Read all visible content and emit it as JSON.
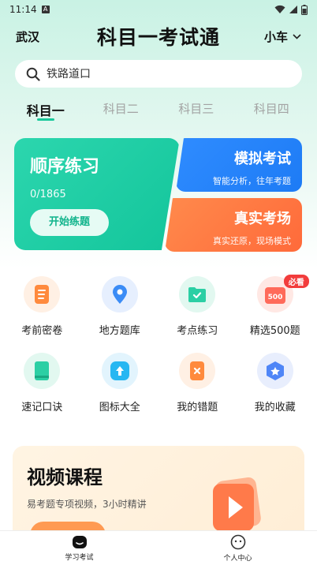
{
  "status_bar": {
    "time": "11:14",
    "sim_label": "A"
  },
  "header": {
    "city": "武汉",
    "title": "科目一考试通",
    "vehicle": "小车"
  },
  "search": {
    "placeholder": "铁路道口"
  },
  "tabs": [
    {
      "label": "科目一",
      "active": true
    },
    {
      "label": "科目二",
      "active": false
    },
    {
      "label": "科目三",
      "active": false
    },
    {
      "label": "科目四",
      "active": false
    }
  ],
  "practice": {
    "title": "顺序练习",
    "progress": "0/1865",
    "button": "开始练题"
  },
  "mock_exam": {
    "title": "模拟考试",
    "subtitle": "智能分析，往年考题"
  },
  "real_exam": {
    "title": "真实考场",
    "subtitle": "真实还原，现场模式"
  },
  "features": [
    {
      "label": "考前密卷",
      "icon": "exam-paper-icon",
      "color": "#ff8a3d"
    },
    {
      "label": "地方题库",
      "icon": "location-pin-icon",
      "color": "#3b8cf6"
    },
    {
      "label": "考点练习",
      "icon": "folder-check-icon",
      "color": "#2ccfa4"
    },
    {
      "label": "精选500题",
      "icon": "500-icon",
      "color": "#ff6a5a",
      "badge": "必看",
      "icon_text": "500"
    },
    {
      "label": "速记口诀",
      "icon": "book-icon",
      "color": "#2ccfa4"
    },
    {
      "label": "图标大全",
      "icon": "upload-arrow-icon",
      "color": "#27b7f2"
    },
    {
      "label": "我的错题",
      "icon": "wrong-answers-icon",
      "color": "#ff8a3d"
    },
    {
      "label": "我的收藏",
      "icon": "star-favorite-icon",
      "color": "#4f86f7"
    }
  ],
  "course": {
    "title": "视频课程",
    "subtitle": "易考题专项视频，3小时精讲"
  },
  "bottom_nav": [
    {
      "label": "学习考试",
      "icon": "study-icon",
      "active": true
    },
    {
      "label": "个人中心",
      "icon": "profile-face-icon",
      "active": false
    }
  ]
}
